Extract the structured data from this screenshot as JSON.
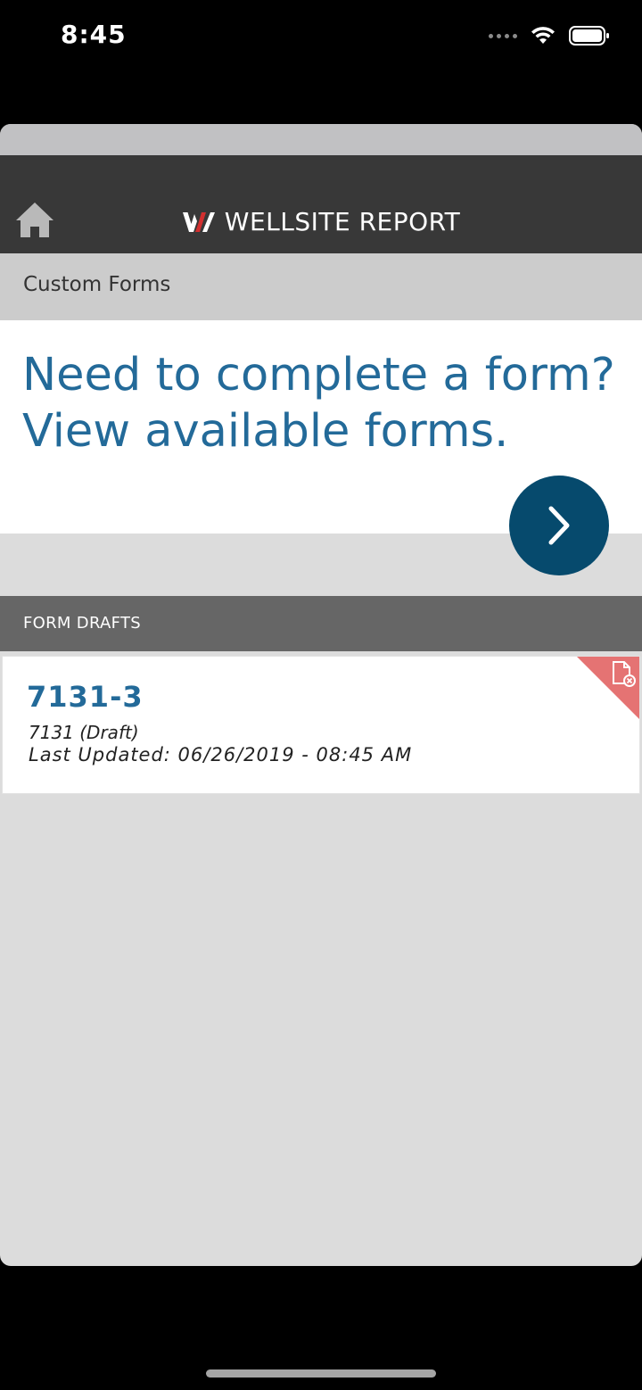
{
  "status_bar": {
    "time": "8:45",
    "icons": [
      "signal-icon",
      "wifi-icon",
      "battery-icon"
    ]
  },
  "header": {
    "title": "WELLSITE REPORT",
    "home_icon": "home-icon"
  },
  "breadcrumb": {
    "label": "Custom Forms"
  },
  "promo": {
    "line1": "Need to complete a form?",
    "line2": "View available forms.",
    "action_icon": "chevron-right-icon"
  },
  "drafts": {
    "section_label": "FORM DRAFTS",
    "items": [
      {
        "title": "7131-3",
        "subtitle": "7131 (Draft)",
        "updated": "Last Updated: 06/26/2019 - 08:45 AM",
        "delete_icon": "delete-document-icon"
      }
    ]
  },
  "colors": {
    "header_bg": "#383838",
    "accent_blue": "#236a99",
    "button_bg": "#064a6d",
    "section_bg": "#666666",
    "delete_red": "#e57373",
    "logo_red": "#d32f2f"
  }
}
